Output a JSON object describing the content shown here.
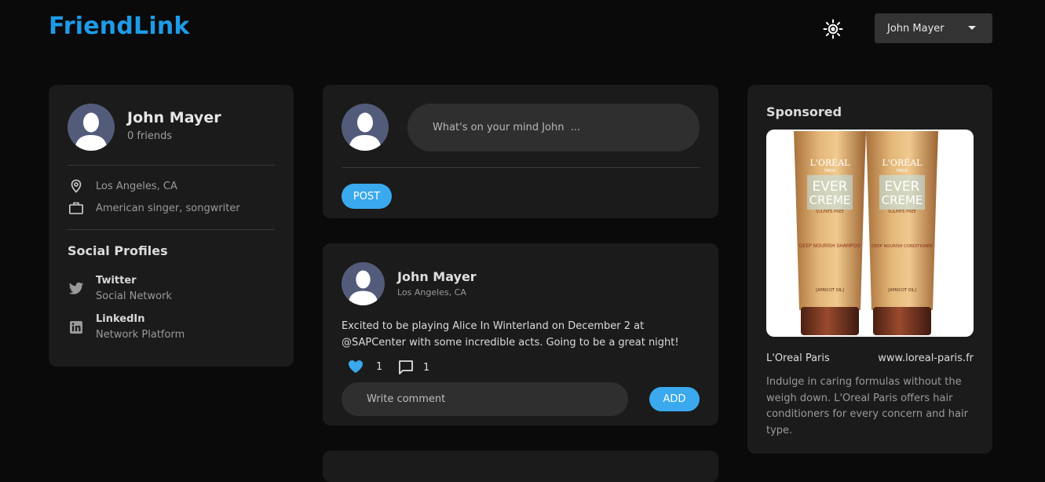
{
  "app": {
    "logo": "FriendLink",
    "accent_color": "#1e9be8",
    "button_color": "#3aa9ee",
    "theme_icon": "sun-icon"
  },
  "header": {
    "user_menu_label": "John Mayer"
  },
  "profile": {
    "name": "John Mayer",
    "friends": "0 friends",
    "location": "Los Angeles, CA",
    "occupation": "American singer, songwriter",
    "social_title": "Social Profiles",
    "socials": [
      {
        "name": "Twitter",
        "type": "Social Network",
        "icon": "twitter-icon"
      },
      {
        "name": "LinkedIn",
        "type": "Network Platform",
        "icon": "linkedin-icon"
      }
    ]
  },
  "composer": {
    "placeholder": "What's on your mind John  ...",
    "post_label": "POST"
  },
  "post": {
    "author": "John Mayer",
    "location": "Los Angeles, CA",
    "text": "Excited to be playing Alice In Winterland on December 2 at @SAPCenter with some incredible acts. Going to be a great night!",
    "likes": "1",
    "comments": "1",
    "comment_placeholder": "Write comment",
    "add_label": "ADD"
  },
  "sponsored": {
    "title": "Sponsored",
    "brand": "L'Oreal Paris",
    "url": "www.loreal-paris.fr",
    "description": "Indulge in caring formulas without the weigh down. L'Oreal Paris offers hair conditioners for every concern and hair type.",
    "product": {
      "brand_mark": "L'ORÉAL",
      "sub_mark": "PARIS",
      "line1": "EVER",
      "line2": "CREME",
      "tag": "SULFATE-FREE",
      "left_name": "DEEP NOURISH SHAMPOO",
      "right_name": "DEEP NOURISH CONDITIONER",
      "note": "[APRICOT OIL]"
    }
  }
}
